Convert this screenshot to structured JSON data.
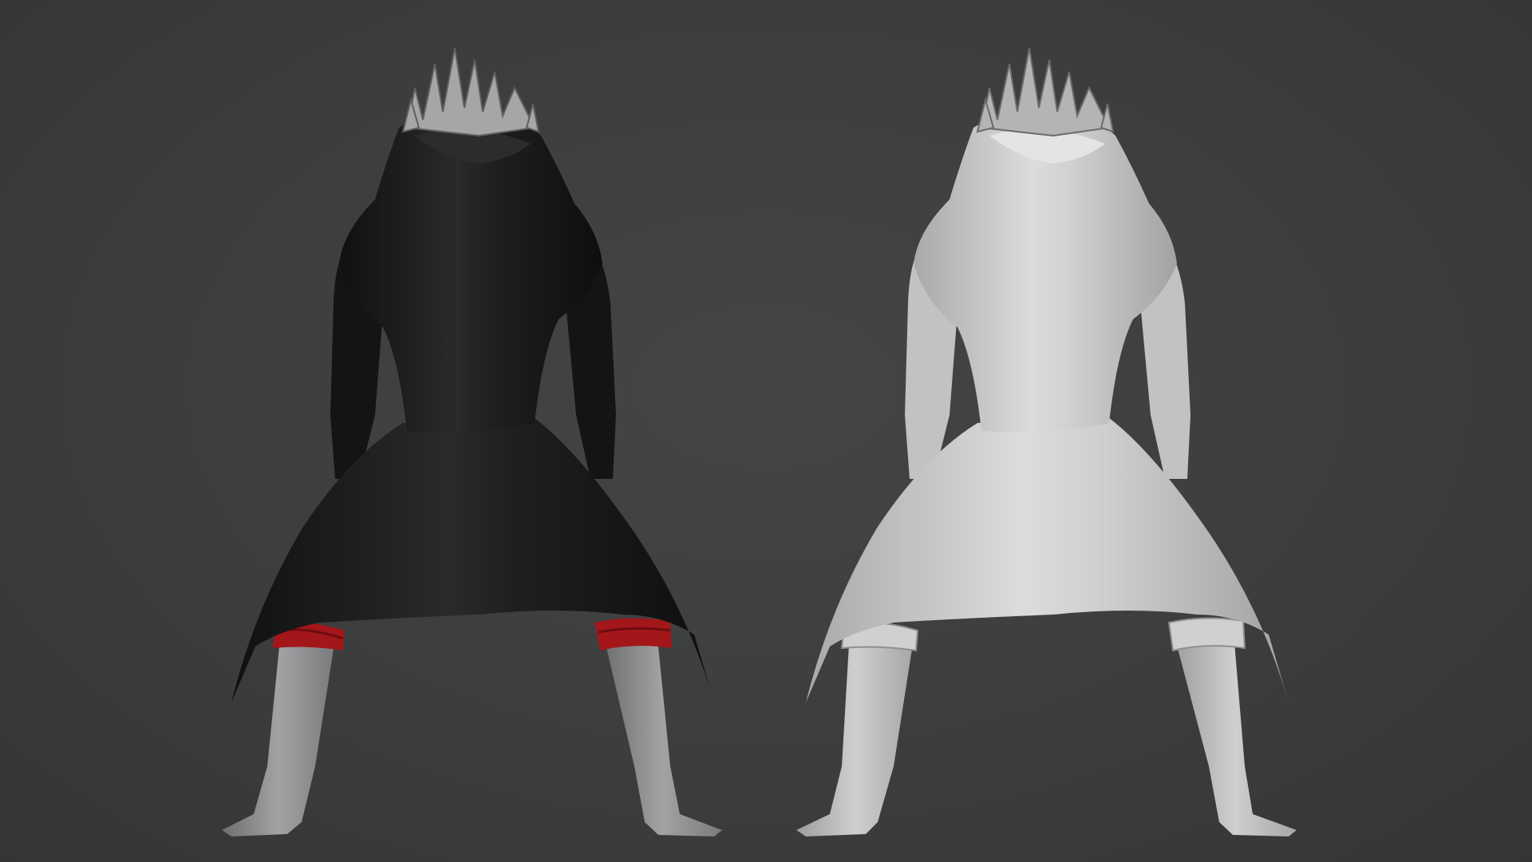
{
  "scene": {
    "background_color": "#3c3d3f",
    "figures": [
      {
        "name": "textured-figure",
        "coat_color": "#1c1c1d",
        "cuff_color": "#b01818",
        "skin_color": "#8e8e90",
        "hair_color": "#a8a8aa"
      },
      {
        "name": "clay-figure",
        "coat_color": "#d2d2d3",
        "cuff_color": "#cfcfd0",
        "skin_color": "#c4c4c6",
        "hair_color": "#b6b6b8"
      }
    ]
  }
}
